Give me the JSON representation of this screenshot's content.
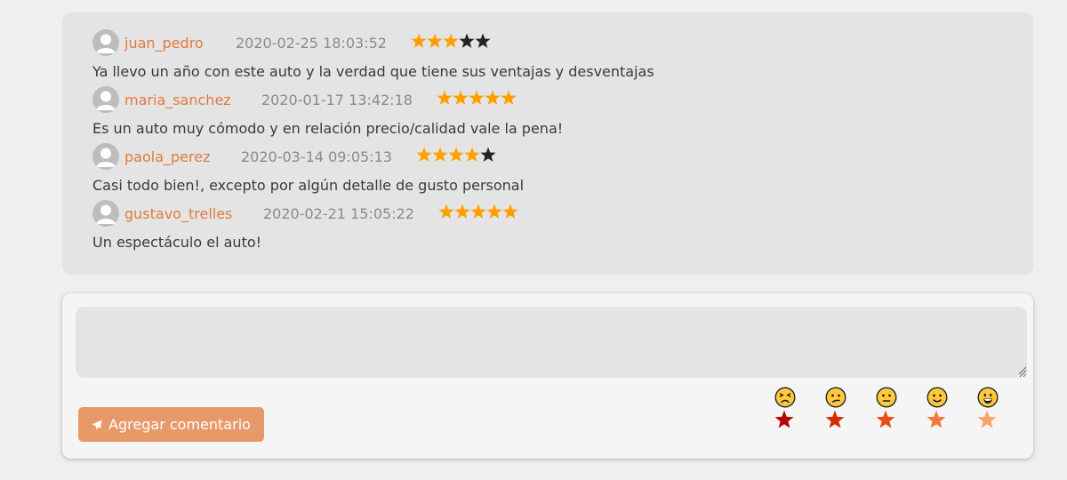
{
  "comments": [
    {
      "username": "juan_pedro",
      "date": "2020-02-25 18:03:52",
      "rating": 3,
      "text": "Ya llevo un año con este auto y la verdad que tiene sus ventajas y desventajas"
    },
    {
      "username": "maria_sanchez",
      "date": "2020-01-17 13:42:18",
      "rating": 5,
      "text": "Es un auto muy cómodo y en relación precio/calidad vale la pena!"
    },
    {
      "username": "paola_perez",
      "date": "2020-03-14 09:05:13",
      "rating": 4,
      "text": "Casi todo bien!, excepto por algún detalle de gusto personal"
    },
    {
      "username": "gustavo_trelles",
      "date": "2020-02-21 15:05:22",
      "rating": 5,
      "text": "Un espectáculo el auto!"
    }
  ],
  "form": {
    "comment_value": "",
    "submit_label": "Agregar comentario",
    "submit_icon": "paper-plane-icon"
  },
  "rating_picker": [
    {
      "face": "tired-face-icon",
      "color": "#b80000"
    },
    {
      "face": "confused-face-icon",
      "color": "#d42c00"
    },
    {
      "face": "neutral-face-icon",
      "color": "#ea4b12"
    },
    {
      "face": "slightly-smiling-face-icon",
      "color": "#f07b3c"
    },
    {
      "face": "grinning-face-icon",
      "color": "#f5a46e"
    }
  ],
  "colors": {
    "star_filled": "#ff9f00",
    "star_empty": "#212529",
    "username": "#e07b3c",
    "button": "#e8996a"
  }
}
